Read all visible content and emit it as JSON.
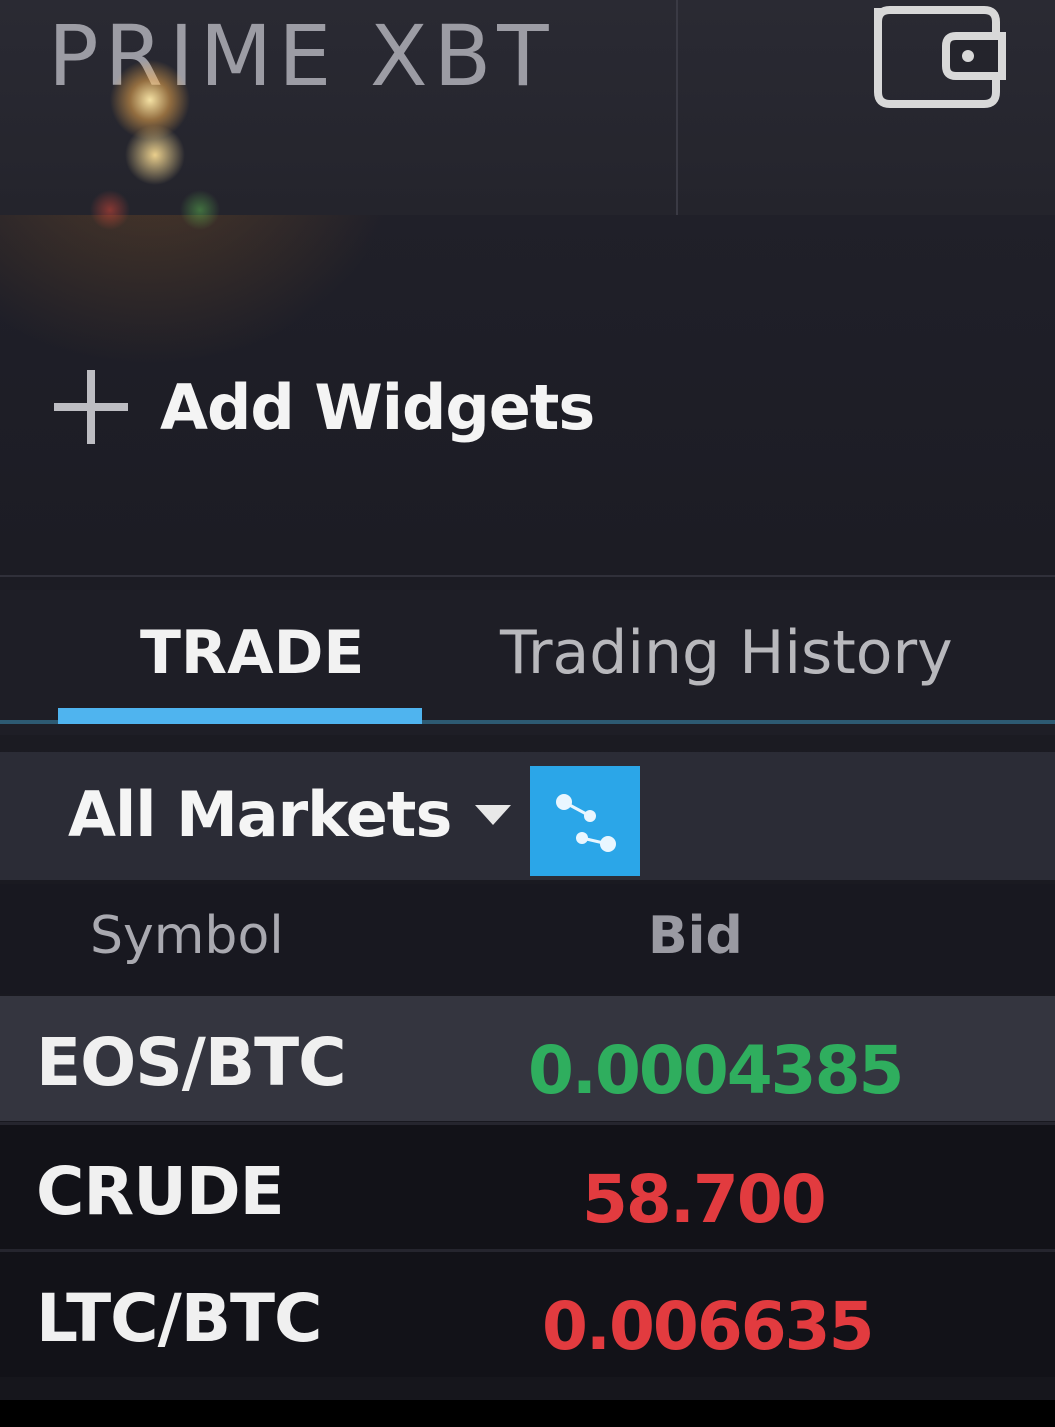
{
  "header": {
    "logo_text": "PRIME XBT",
    "wallet_icon": "wallet-icon"
  },
  "widgets": {
    "add_label": "Add Widgets",
    "icon": "plus-icon"
  },
  "tabs": [
    {
      "label": "TRADE",
      "active": true
    },
    {
      "label": "Trading History",
      "active": false
    }
  ],
  "toolbar": {
    "market_filter": "All Markets",
    "caret_icon": "caret-down-icon",
    "connect_icon": "connection-nodes-icon"
  },
  "table": {
    "columns": [
      "Symbol",
      "Bid"
    ],
    "rows": [
      {
        "symbol": "EOS/BTC",
        "bid": "0.0004385",
        "direction": "up"
      },
      {
        "symbol": "CRUDE",
        "bid": "58.700",
        "direction": "down"
      },
      {
        "symbol": "LTC/BTC",
        "bid": "0.006635",
        "direction": "down"
      }
    ]
  },
  "colors": {
    "accent": "#4fb4ef",
    "up": "#2fae5e",
    "down": "#e23b3f"
  }
}
